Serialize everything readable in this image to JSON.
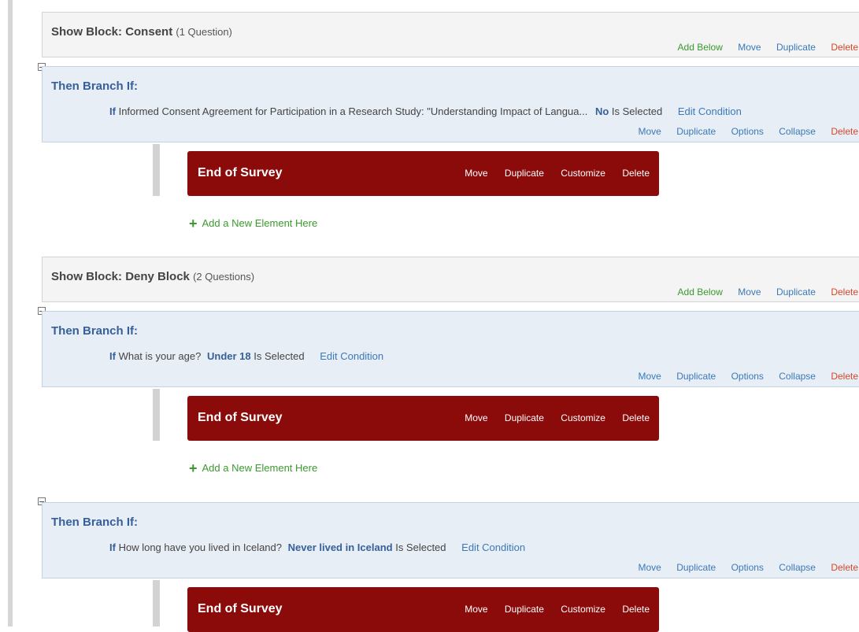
{
  "labels": {
    "show_block_prefix": "Show Block:",
    "then_branch": "Then Branch If:",
    "if_kw": "If",
    "is_selected": "Is Selected",
    "edit_condition": "Edit Condition",
    "end_of_survey": "End of Survey",
    "add_new_element": "Add a New Element Here"
  },
  "block_actions": {
    "add_below": "Add Below",
    "move": "Move",
    "duplicate": "Duplicate",
    "delete": "Delete"
  },
  "branch_actions": {
    "move": "Move",
    "duplicate": "Duplicate",
    "options": "Options",
    "collapse": "Collapse",
    "delete": "Delete"
  },
  "eos_actions": {
    "move": "Move",
    "duplicate": "Duplicate",
    "customize": "Customize",
    "delete": "Delete"
  },
  "blocks": [
    {
      "name": "Consent",
      "count": "(1 Question)"
    },
    {
      "name": "Deny Block",
      "count": "(2 Questions)"
    }
  ],
  "branches": [
    {
      "question": "Informed Consent Agreement for Participation in a Research Study: \"Understanding Impact of Langua...",
      "answer": "No"
    },
    {
      "question": "What is your age?",
      "answer": "Under 18"
    },
    {
      "question": "How long have you lived in Iceland?",
      "answer": "Never lived in Iceland"
    }
  ],
  "colors": {
    "end_of_survey_bg": "#8b0a0a",
    "link_blue": "#3b79b8",
    "add_green": "#3a9a2f",
    "delete_red": "#d5462a",
    "branch_title": "#36609a"
  }
}
